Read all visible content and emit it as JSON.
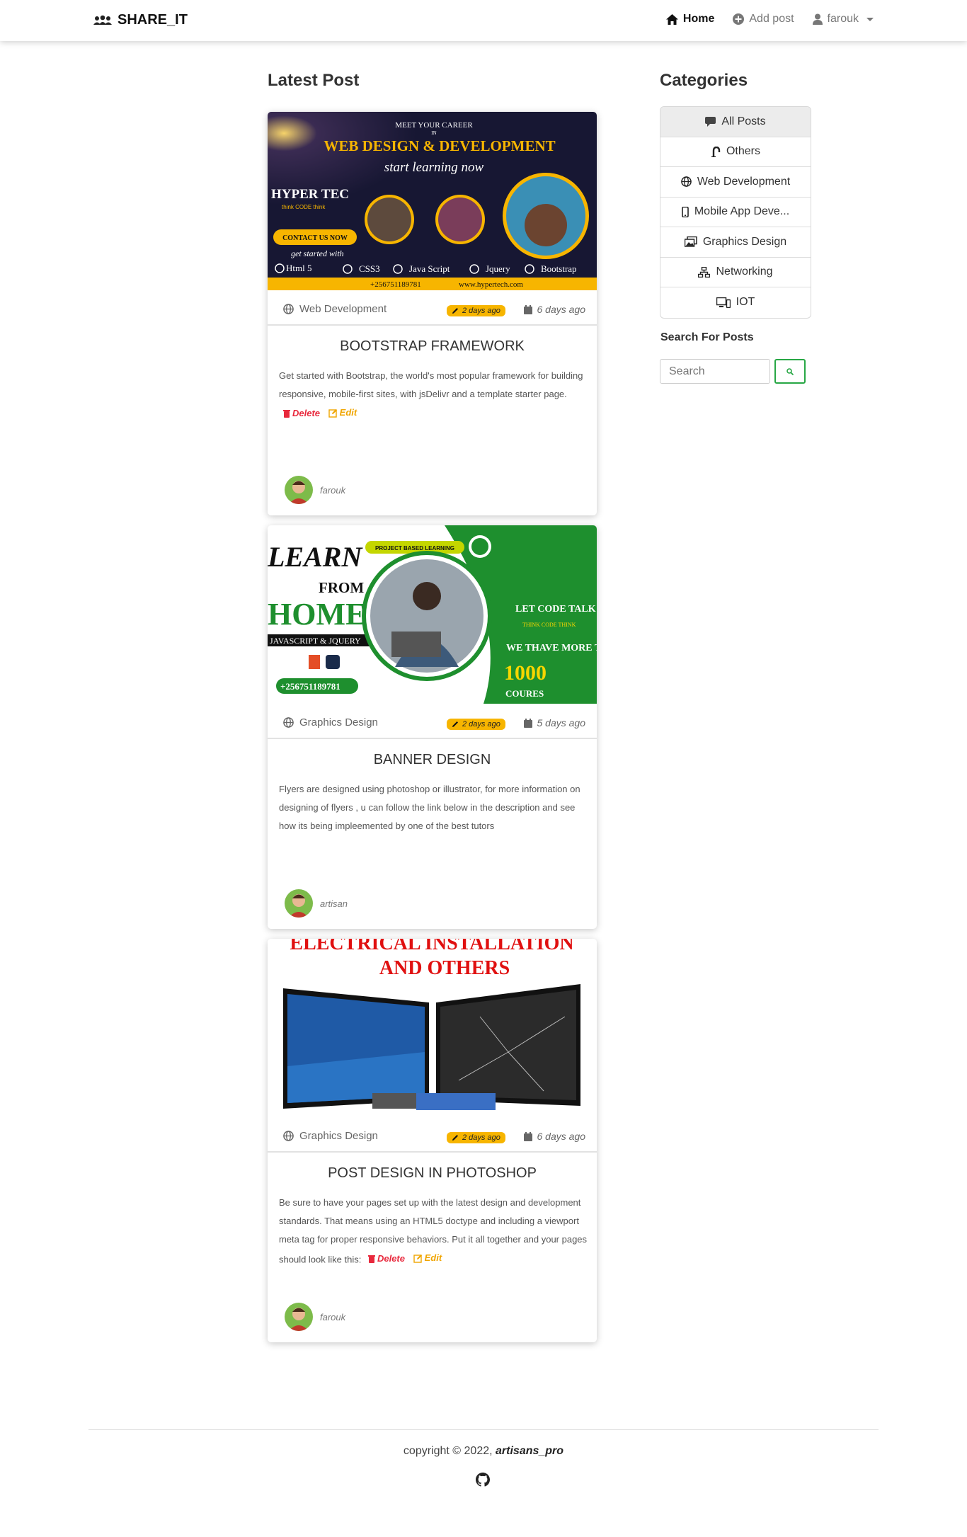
{
  "navbar": {
    "brand": "SHARE_IT",
    "home": "Home",
    "add_post": "Add post",
    "user": "farouk"
  },
  "main": {
    "heading": "Latest Post"
  },
  "posts": [
    {
      "image_caption": {
        "line1": "MEET YOUR CAREER",
        "line2": "IN",
        "line3": "WEB DESIGN & DEVELOPMENT",
        "line4": "start learning now",
        "brand": "HYPER TEC",
        "tagline": "think CODE think",
        "cta": "CONTACT US NOW",
        "get_started": "get started with",
        "techs": [
          "Html 5",
          "CSS3",
          "Java Script",
          "Jquery",
          "Bootstrap"
        ],
        "phone": "+256751189781",
        "site": "www.hypertech.com"
      },
      "category": "Web Development",
      "badge": "2 days ago",
      "date": "6 days ago",
      "title": "BOOTSTRAP FRAMEWORK",
      "body": "Get started with Bootstrap, the world's most popular framework for building responsive, mobile-first sites, with jsDelivr and a template starter page.",
      "delete_label": "Delete",
      "edit_label": "Edit",
      "author": "farouk"
    },
    {
      "image_caption": {
        "learn": "LEARN",
        "from": "FROM",
        "home": "HOME",
        "js": "JAVASCRIPT & JQUERY",
        "phone": "+256751189781",
        "pbl": "PROJECT BASED LEARNING",
        "lct": "LET CODE TALK",
        "tct": "THINK CODE THINK",
        "more": "WE THAVE MORE THAN",
        "count": "1000",
        "courses": "COURES"
      },
      "category": "Graphics Design",
      "badge": "2 days ago",
      "date": "5 days ago",
      "title": "BANNER DESIGN",
      "body": "Flyers are designed using photoshop or illustrator, for more information on designing of flyers , u can follow the link below in the description and see how its being impleemented by one of the best tutors",
      "author": "artisan"
    },
    {
      "image_caption": {
        "line1": "ELECTRICAL INSTALLATION",
        "line2": "AND OTHERS"
      },
      "category": "Graphics Design",
      "badge": "2 days ago",
      "date": "6 days ago",
      "title": "POST DESIGN IN PHOTOSHOP",
      "body": "Be sure to have your pages set up with the latest design and development standards. That means using an HTML5 doctype and including a viewport meta tag for proper responsive behaviors. Put it all together and your pages should look like this:",
      "delete_label": "Delete",
      "edit_label": "Edit",
      "author": "farouk"
    }
  ],
  "sidebar": {
    "heading": "Categories",
    "items": [
      {
        "label": "All Posts",
        "icon": "chat-icon"
      },
      {
        "label": "Others",
        "icon": "link-icon"
      },
      {
        "label": "Web Development",
        "icon": "globe-icon"
      },
      {
        "label": "Mobile App Deve...",
        "icon": "phone-icon"
      },
      {
        "label": "Graphics Design",
        "icon": "images-icon"
      },
      {
        "label": "Networking",
        "icon": "network-icon"
      },
      {
        "label": "IOT",
        "icon": "devices-icon"
      }
    ],
    "search_label": "Search For Posts",
    "search_placeholder": "Search"
  },
  "footer": {
    "copyright": "copyright © 2022,",
    "owner": "artisans_pro"
  },
  "colors": {
    "badge": "#f7b500",
    "delete": "#e8283c",
    "edit": "#f0a500",
    "search_button_border": "#28a745"
  }
}
